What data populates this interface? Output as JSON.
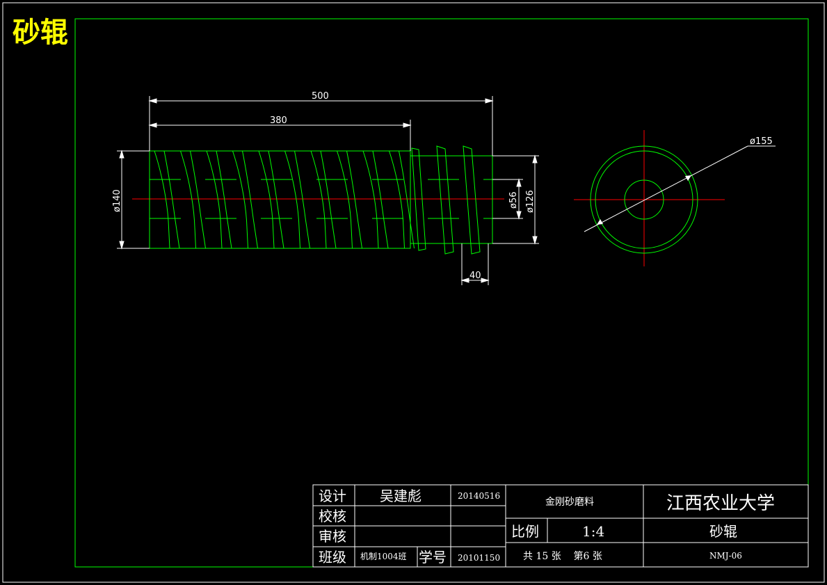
{
  "drawing_title": "砂辊",
  "colors": {
    "background": "#000000",
    "outline": "#ffffff",
    "frame": "#00ff00",
    "geometry": "#00ff00",
    "centerline": "#ff0000",
    "title": "#ffff00"
  },
  "dimensions": {
    "total_length": "500",
    "thread_length": "380",
    "outer_diameter": "ø140",
    "bore_diameter": "ø56",
    "hub_diameter": "ø126",
    "end_width": "40",
    "end_view_diameter": "ø155"
  },
  "title_block": {
    "design_label": "设计",
    "designer": "吴建彪",
    "design_date": "20140516",
    "check_label": "校核",
    "review_label": "审核",
    "class_label": "班级",
    "class_value": "机制1004班",
    "student_no_label": "学号",
    "student_no": "20101150",
    "material": "金刚砂磨料",
    "scale_label": "比例",
    "scale_value": "1:4",
    "sheet_info": "共 15 张    第6 张",
    "university": "江西农业大学",
    "part_name": "砂辊",
    "drawing_no": "NMJ-06"
  }
}
